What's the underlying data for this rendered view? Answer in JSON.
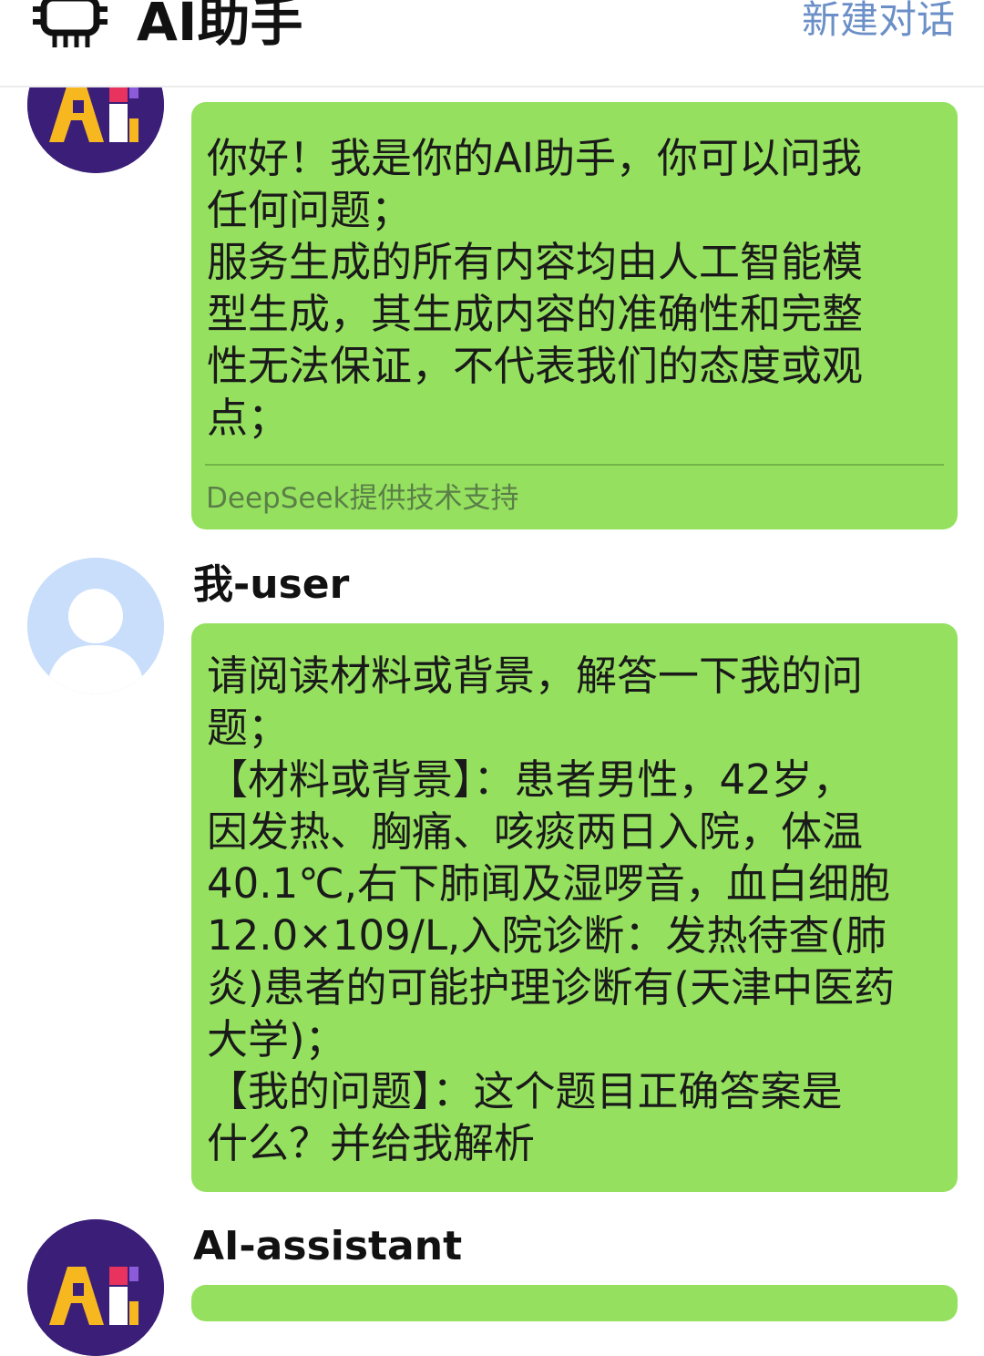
{
  "header": {
    "title": "AI助手",
    "new_chat_label": "新建对话",
    "icon": "robot-icon"
  },
  "messages": [
    {
      "sender": "ai",
      "avatar_label": "AI",
      "text": "你好！我是你的AI助手，你可以问我\n任何问题；\n服务生成的所有内容均由人工智能模\n型生成，其生成内容的准确性和完整\n性无法保证，不代表我们的态度或观\n点；",
      "footer": "DeepSeek提供技术支持"
    },
    {
      "sender": "user",
      "name": "我-user",
      "text": "请阅读材料或背景，解答一下我的问\n题；\n【材料或背景】：患者男性，42岁，\n因发热、胸痛、咳痰两日入院，体温\n40.1℃,右下肺闻及湿啰音，血白细胞\n12.0×109/L,入院诊断：发热待查(肺\n炎)患者的可能护理诊断有(天津中医药\n大学)；\n【我的问题】：这个题目正确答案是\n什么？并给我解析"
    },
    {
      "sender": "ai",
      "name": "AI-assistant",
      "avatar_label": "AI"
    }
  ],
  "colors": {
    "bubble": "#95e15f",
    "accent_link": "#6b8fc7",
    "ai_avatar_bg": "#3a1e78",
    "user_avatar_bg": "#c9defb"
  }
}
